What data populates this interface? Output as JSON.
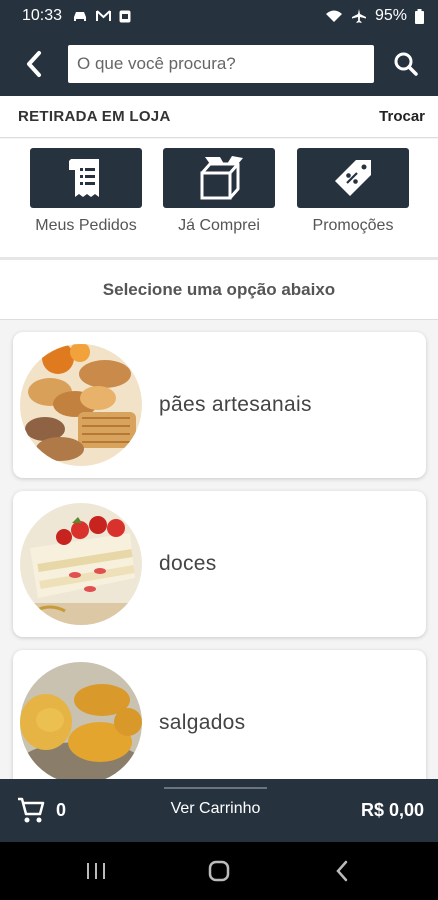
{
  "status_bar": {
    "time": "10:33",
    "battery": "95%"
  },
  "header": {
    "search_placeholder": "O que você procura?"
  },
  "pickup": {
    "mode": "RETIRADA EM LOJA",
    "change_label": "Trocar"
  },
  "quick_actions": [
    {
      "label": "Meus Pedidos",
      "icon": "receipt-icon"
    },
    {
      "label": "Já Comprei",
      "icon": "open-box-icon"
    },
    {
      "label": "Promoções",
      "icon": "discount-tag-icon"
    }
  ],
  "subtitle": "Selecione uma opção abaixo",
  "categories": [
    {
      "label": "pães artesanais",
      "image": "bread-photo"
    },
    {
      "label": "doces",
      "image": "strawberry-cake-photo"
    },
    {
      "label": "salgados",
      "image": "fried-snacks-photo"
    }
  ],
  "cart": {
    "count": "0",
    "view_label": "Ver Carrinho",
    "total": "R$ 0,00"
  },
  "colors": {
    "primary": "#27323f",
    "background": "#f4f4f4",
    "card": "#ffffff"
  }
}
